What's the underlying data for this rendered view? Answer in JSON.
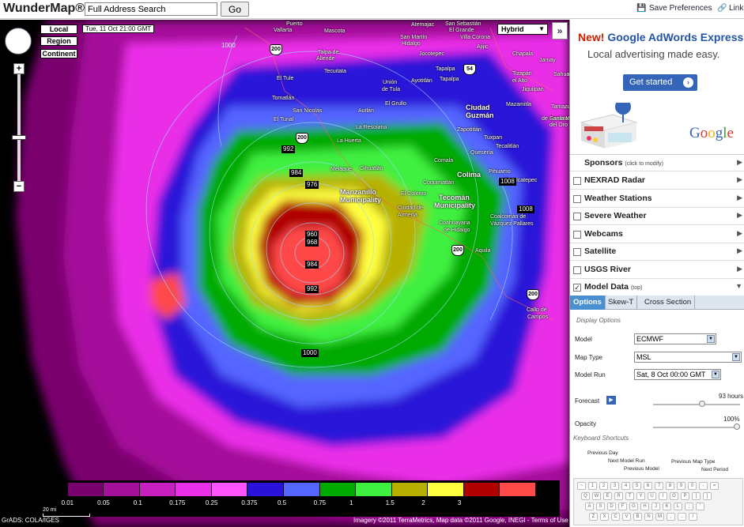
{
  "header": {
    "logo": "WunderMap®",
    "search_value": "Full Address Search",
    "go_label": "Go",
    "save_prefs": "Save Preferences",
    "link": "Link"
  },
  "map": {
    "view_buttons": [
      "Local",
      "Region",
      "Continent"
    ],
    "timestamp": "Tue, 11 Oct 21:00 GMT",
    "map_type": "Hybrid",
    "collapse": "»",
    "zoom_in": "+",
    "zoom_out": "−",
    "places": [
      {
        "t": "Puerto",
        "c": "place"
      },
      {
        "t": "Vallarta",
        "c": "place"
      },
      {
        "t": "Mascota",
        "c": "place"
      },
      {
        "t": "Talpa de",
        "c": "place"
      },
      {
        "t": "Allende",
        "c": "place"
      },
      {
        "t": "El Tule",
        "c": "place"
      },
      {
        "t": "Tomatlán",
        "c": "place"
      },
      {
        "t": "San Nicolás",
        "c": "place"
      },
      {
        "t": "El Tunal",
        "c": "place"
      },
      {
        "t": "La Huerta",
        "c": "place"
      },
      {
        "t": "Melaque",
        "c": "place"
      },
      {
        "t": "Cihuatlán",
        "c": "place"
      },
      {
        "t": "Manzanillo",
        "c": "place big"
      },
      {
        "t": "Municipality",
        "c": "place big"
      },
      {
        "t": "El Colomo",
        "c": "place"
      },
      {
        "t": "Ciudad de",
        "c": "place"
      },
      {
        "t": "Armería",
        "c": "place"
      },
      {
        "t": "Tecomán",
        "c": "place big"
      },
      {
        "t": "Municipality",
        "c": "place big"
      },
      {
        "t": "Coahuayana",
        "c": "place"
      },
      {
        "t": "de Hidalgo",
        "c": "place"
      },
      {
        "t": "Colima",
        "c": "place big"
      },
      {
        "t": "Comala",
        "c": "place"
      },
      {
        "t": "Coquimatlán",
        "c": "place"
      },
      {
        "t": "Ciudad",
        "c": "place big"
      },
      {
        "t": "Guzmán",
        "c": "place big"
      },
      {
        "t": "Autlán",
        "c": "place"
      },
      {
        "t": "El Grullo",
        "c": "place"
      },
      {
        "t": "La Resolana",
        "c": "place"
      },
      {
        "t": "Unión",
        "c": "place"
      },
      {
        "t": "de Tula",
        "c": "place"
      },
      {
        "t": "Tapalpa",
        "c": "place"
      },
      {
        "t": "Zapotitlán",
        "c": "place"
      },
      {
        "t": "Tuxpan",
        "c": "place"
      },
      {
        "t": "Quesería",
        "c": "place"
      },
      {
        "t": "Tecalitlán",
        "c": "place"
      },
      {
        "t": "Pihuamo",
        "c": "place"
      },
      {
        "t": "Tepalcatepec",
        "c": "place"
      },
      {
        "t": "Coalcomán de",
        "c": "place"
      },
      {
        "t": "Vázquez Pallares",
        "c": "place"
      },
      {
        "t": "Aquila",
        "c": "place"
      },
      {
        "t": "Villa Corona",
        "c": "place"
      },
      {
        "t": "Jocotepec",
        "c": "place"
      },
      {
        "t": "Chapala",
        "c": "place"
      },
      {
        "t": "Sahuayo",
        "c": "place"
      },
      {
        "t": "Jamay",
        "c": "place"
      },
      {
        "t": "Tizapán",
        "c": "place"
      },
      {
        "t": "el Alto",
        "c": "place"
      },
      {
        "t": "Mazamitla",
        "c": "place"
      },
      {
        "t": "Jiquilpan",
        "c": "place"
      },
      {
        "t": "Tamazula",
        "c": "place"
      },
      {
        "t": "de Gordiano",
        "c": "place"
      },
      {
        "t": "Santa María",
        "c": "place"
      },
      {
        "t": "del Oro",
        "c": "place"
      },
      {
        "t": "Callo de",
        "c": "place"
      },
      {
        "t": "Campos",
        "c": "place"
      },
      {
        "t": "San Sebastián",
        "c": "place"
      },
      {
        "t": "El Grande",
        "c": "place"
      },
      {
        "t": "San Martín",
        "c": "place"
      },
      {
        "t": "Hidalgo",
        "c": "place"
      },
      {
        "t": "Ajijic",
        "c": "place"
      },
      {
        "t": "Atemajac",
        "c": "place"
      },
      {
        "t": "Tapalpa",
        "c": "place"
      },
      {
        "t": "Ayotitlán",
        "c": "place"
      },
      {
        "t": "Tecuitata",
        "c": "place"
      }
    ],
    "isobars": [
      "1000",
      "992",
      "984",
      "976",
      "960",
      "968",
      "984",
      "992",
      "1000",
      "1008",
      "1008"
    ],
    "highways": [
      "200",
      "200",
      "200",
      "54",
      "200",
      "200",
      "200"
    ],
    "legend_labels": [
      "0.01",
      "0.05",
      "0.1",
      "0.175",
      "0.25",
      "0.375",
      "0.5",
      "0.75",
      "1",
      "1.5",
      "2",
      "3"
    ],
    "legend_colors": [
      "#000000",
      "#7a006e",
      "#a4109a",
      "#c81fc0",
      "#ea2fe8",
      "#ff55ff",
      "#2a12d8",
      "#5565ff",
      "#00aa00",
      "#40f040",
      "#b8b000",
      "#ffff40",
      "#b00000",
      "#ff4a4a"
    ],
    "scale": "20 mi",
    "gads": "GrADS: COLA/IGES",
    "attribution": "Imagery ©2011 TerraMetrics, Map data ©2011 Google, INEGI - Terms of Use"
  },
  "sidebar": {
    "ad": {
      "title_new": "New!",
      "title_rest": "Google AdWords Express",
      "subtitle": "Local advertising made easy.",
      "button": "Get started",
      "logo": "Google"
    },
    "sponsors": "Sponsors",
    "sponsors_note": "(click to modify)",
    "layers": [
      "NEXRAD Radar",
      "Weather Stations",
      "Severe Weather",
      "Webcams",
      "Satellite",
      "USGS River"
    ],
    "model_data": "Model Data",
    "model_data_note": "(top)",
    "tabs": [
      "Options",
      "Skew-T",
      "Cross Section"
    ],
    "display_options": "Display Options",
    "model_label": "Model",
    "model_value": "ECMWF",
    "map_type_label": "Map Type",
    "map_type_value": "MSL",
    "model_run_label": "Model Run",
    "model_run_value": "Sat, 8 Oct 00:00 GMT",
    "forecast_label": "Forecast",
    "forecast_value": "93 hours",
    "opacity_label": "Opacity",
    "opacity_value": "100%",
    "keyboard_shortcuts": "Keyboard Shortcuts",
    "kb_labels": [
      "Previous Day",
      "Next Model Run",
      "Previous Model",
      "Previous Map Type",
      "Next Period"
    ]
  }
}
